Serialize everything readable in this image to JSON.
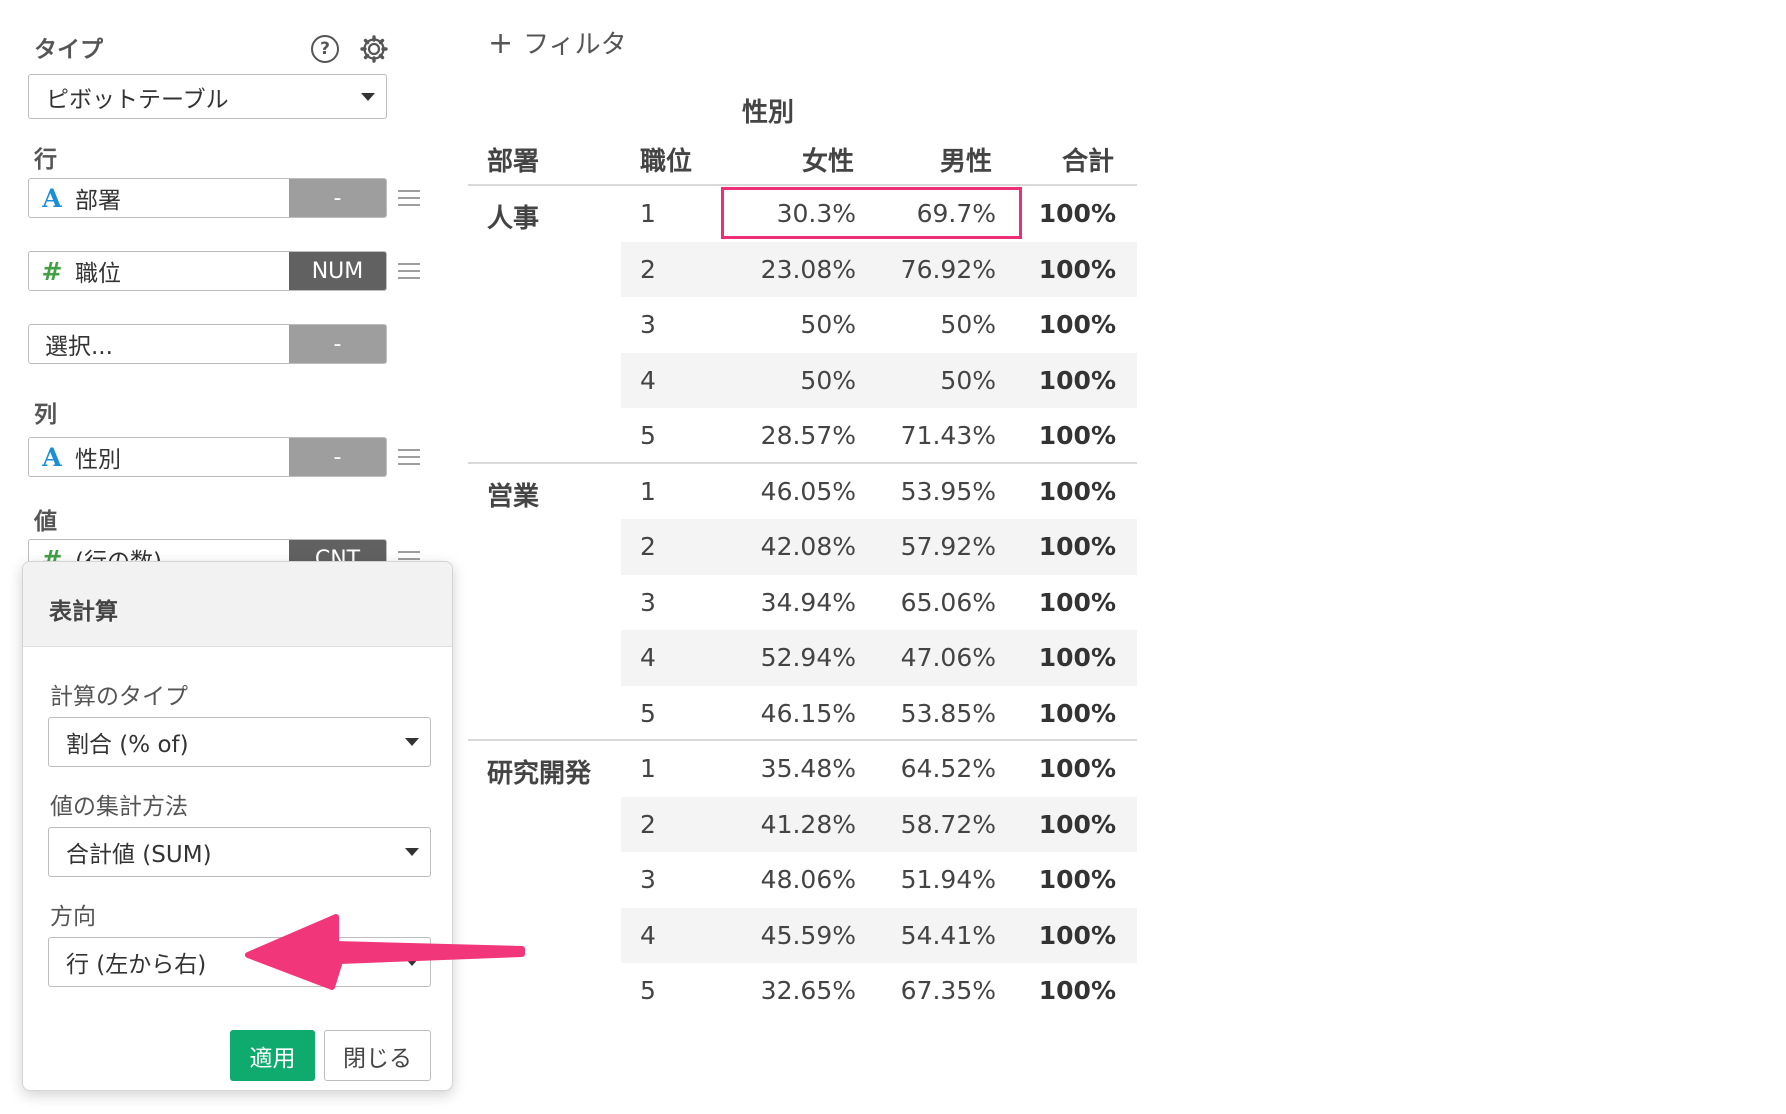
{
  "config": {
    "type_label": "タイプ",
    "type_value": "ピボットテーブル",
    "rows_label": "行",
    "rows": [
      {
        "type": "A",
        "name": "部署",
        "badge": "-"
      },
      {
        "type": "#",
        "name": "職位",
        "badge": "NUM"
      },
      {
        "type": "",
        "name": "選択...",
        "badge": "-"
      }
    ],
    "cols_label": "列",
    "cols": [
      {
        "type": "A",
        "name": "性別",
        "badge": "-"
      }
    ],
    "values_label": "値",
    "values": [
      {
        "type": "#",
        "name": "(行の数)",
        "badge": "CNT"
      }
    ]
  },
  "popup": {
    "title": "表計算",
    "calc_type_label": "計算のタイプ",
    "calc_type_value": "割合 (% of)",
    "agg_label": "値の集計方法",
    "agg_value": "合計値 (SUM)",
    "direction_label": "方向",
    "direction_value": "行 (左から右)",
    "apply_label": "適用",
    "close_label": "閉じる"
  },
  "filter": {
    "label": "フィルタ",
    "plus": "+"
  },
  "colors": {
    "accent_green": "#0faa6e",
    "highlight": "#ee2f78",
    "arrow": "#f2367a"
  },
  "table": {
    "col_group_header": "性別",
    "headers": [
      "部署",
      "職位",
      "女性",
      "男性",
      "合計"
    ],
    "groups": [
      {
        "dept": "人事",
        "rows": [
          {
            "pos": "1",
            "f": "30.3%",
            "m": "69.7%",
            "total": "100%"
          },
          {
            "pos": "2",
            "f": "23.08%",
            "m": "76.92%",
            "total": "100%"
          },
          {
            "pos": "3",
            "f": "50%",
            "m": "50%",
            "total": "100%"
          },
          {
            "pos": "4",
            "f": "50%",
            "m": "50%",
            "total": "100%"
          },
          {
            "pos": "5",
            "f": "28.57%",
            "m": "71.43%",
            "total": "100%"
          }
        ]
      },
      {
        "dept": "営業",
        "rows": [
          {
            "pos": "1",
            "f": "46.05%",
            "m": "53.95%",
            "total": "100%"
          },
          {
            "pos": "2",
            "f": "42.08%",
            "m": "57.92%",
            "total": "100%"
          },
          {
            "pos": "3",
            "f": "34.94%",
            "m": "65.06%",
            "total": "100%"
          },
          {
            "pos": "4",
            "f": "52.94%",
            "m": "47.06%",
            "total": "100%"
          },
          {
            "pos": "5",
            "f": "46.15%",
            "m": "53.85%",
            "total": "100%"
          }
        ]
      },
      {
        "dept": "研究開発",
        "rows": [
          {
            "pos": "1",
            "f": "35.48%",
            "m": "64.52%",
            "total": "100%"
          },
          {
            "pos": "2",
            "f": "41.28%",
            "m": "58.72%",
            "total": "100%"
          },
          {
            "pos": "3",
            "f": "48.06%",
            "m": "51.94%",
            "total": "100%"
          },
          {
            "pos": "4",
            "f": "45.59%",
            "m": "54.41%",
            "total": "100%"
          },
          {
            "pos": "5",
            "f": "32.65%",
            "m": "67.35%",
            "total": "100%"
          }
        ]
      }
    ]
  }
}
